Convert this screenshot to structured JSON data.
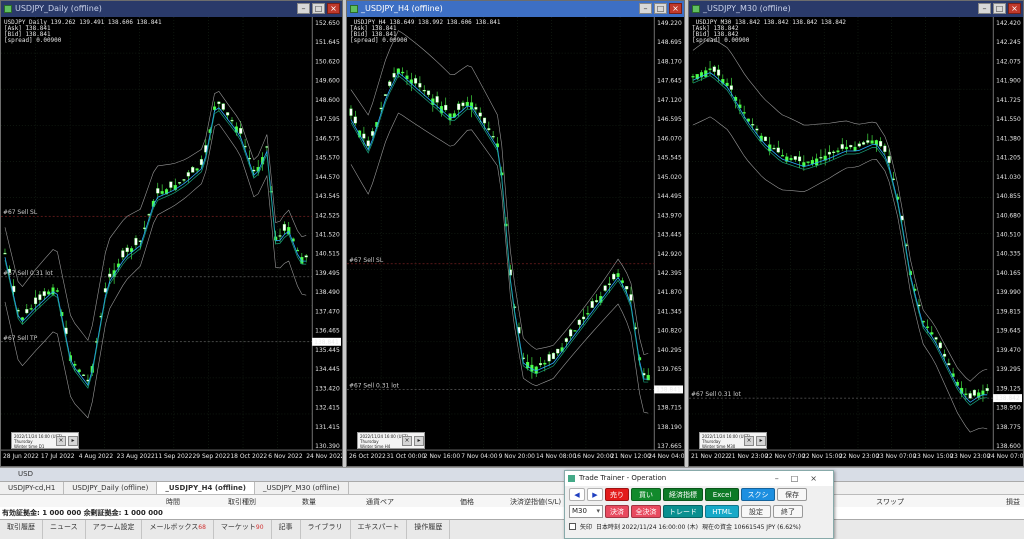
{
  "windows": [
    {
      "title": "USDJPY_Daily (offline)",
      "info": [
        "USDJPY_Daily 139.262 139.491 138.606 138.841",
        "[Ask] 138.841",
        "[Bid] 138.841",
        "[spread] 0.00900"
      ],
      "prices": [
        "152.650",
        "151.645",
        "150.620",
        "149.600",
        "148.600",
        "147.595",
        "146.575",
        "145.570",
        "144.570",
        "143.545",
        "142.525",
        "141.520",
        "140.515",
        "139.495",
        "138.490",
        "137.470",
        "136.465",
        "135.445",
        "134.445",
        "133.420",
        "132.415",
        "131.415",
        "130.390"
      ],
      "dates": [
        "28 Jun 2022",
        "17 Jul 2022",
        "4 Aug 2022",
        "23 Aug 2022",
        "11 Sep 2022",
        "29 Sep 2022",
        "18 Oct 2022",
        "6 Nov 2022",
        "24 Nov 2022"
      ],
      "levels": [
        {
          "text": "#67 Sell SL"
        },
        {
          "text": "#67 Sell 0.31 lot"
        },
        {
          "text": "#67 Sell TP"
        }
      ],
      "current": "138.841",
      "minibox": {
        "line1": "2022/11/24 16:00 (UST)",
        "line2": "Thursday",
        "line3": "Winter time    D1"
      }
    },
    {
      "title": "_USDJPY_H4 (offline)",
      "info": [
        "_USDJPY_H4 138.649 138.992 138.606 138.841",
        "[Ask] 138.841",
        "[Bid] 138.841",
        "[spread] 0.00900"
      ],
      "prices": [
        "149.220",
        "148.695",
        "148.170",
        "147.645",
        "147.120",
        "146.595",
        "146.070",
        "145.545",
        "145.020",
        "144.495",
        "143.970",
        "143.445",
        "142.920",
        "142.395",
        "141.870",
        "141.345",
        "140.820",
        "140.295",
        "139.765",
        "139.240",
        "138.715",
        "138.190",
        "137.665"
      ],
      "dates": [
        "26 Oct 2022",
        "31 Oct 00:00",
        "2 Nov 16:00",
        "7 Nov 04:00",
        "9 Nov 20:00",
        "14 Nov 08:00",
        "16 Nov 20:00",
        "21 Nov 12:00",
        "24 Nov 04:00"
      ],
      "levels": [
        {
          "text": "#67 Sell SL"
        },
        {
          "text": "#67 Sell 0.31 lot"
        }
      ],
      "current": "138.841",
      "minibox": {
        "line1": "2022/11/24 16:00 (UST)",
        "line2": "Thursday",
        "line3": "Winter time    H4"
      }
    },
    {
      "title": "_USDJPY_M30 (offline)",
      "info": [
        "_USDJPY_M30 138.842 138.842 138.842 138.842",
        "[Ask] 138.842",
        "[Bid] 138.842",
        "[spread] 0.00900"
      ],
      "prices": [
        "142.420",
        "142.245",
        "142.075",
        "141.900",
        "141.725",
        "141.550",
        "141.380",
        "141.205",
        "141.030",
        "140.855",
        "140.680",
        "140.510",
        "140.335",
        "140.165",
        "139.990",
        "139.815",
        "139.645",
        "139.470",
        "139.295",
        "139.125",
        "138.950",
        "138.775",
        "138.600"
      ],
      "dates": [
        "21 Nov 2022",
        "21 Nov 23:00",
        "22 Nov 07:00",
        "22 Nov 15:00",
        "22 Nov 23:00",
        "23 Nov 07:00",
        "23 Nov 15:00",
        "23 Nov 23:00",
        "24 Nov 07:00"
      ],
      "levels": [
        {
          "text": "#67 Sell 0.31 lot"
        }
      ],
      "current": "138.842",
      "minibox": {
        "line1": "2022/11/24 16:00 (UST)",
        "line2": "Thursday",
        "line3": "Winter time    M30"
      }
    }
  ],
  "strip": "USD",
  "tabs": [
    "USDJPY-cd,H1",
    "USDJPY_Daily (offline)",
    "_USDJPY_H4 (offline)",
    "_USDJPY_M30 (offline)"
  ],
  "terminal_headers": [
    "時間",
    "取引種別",
    "数量",
    "通貨ペア",
    "価格",
    "決済逆指値(S/L)",
    "スワップ",
    "損益"
  ],
  "terminal_row": "有効証拠金: 1 000 000  余剰証拠金: 1 000 000",
  "bottom_tabs": [
    {
      "label": "取引履歴"
    },
    {
      "label": "ニュース"
    },
    {
      "label": "アラーム設定"
    },
    {
      "label": "メールボックス",
      "badge": "68"
    },
    {
      "label": "マーケット",
      "badge": "90"
    },
    {
      "label": "記事"
    },
    {
      "label": "ライブラリ"
    },
    {
      "label": "エキスパート"
    },
    {
      "label": "操作履歴"
    }
  ],
  "trainer": {
    "title": "Trade Trainer - Operation",
    "prev": "◀",
    "next": "▶",
    "sell": "売り",
    "buy": "買い",
    "limit": "経済指標",
    "excel": "Excel",
    "screenshot": "スクショ",
    "save": "保存",
    "timeframe": "M30",
    "close": "決済",
    "close_all": "全決済",
    "trade": "トレード",
    "html": "HTML",
    "settings": "設定",
    "exit": "終了",
    "arrow_label": "矢印",
    "time_text": "日本時刻 2022/11/24 16:00:00 (木)",
    "funds_text": "現在の資金 10661545 JPY (6.62%)"
  }
}
